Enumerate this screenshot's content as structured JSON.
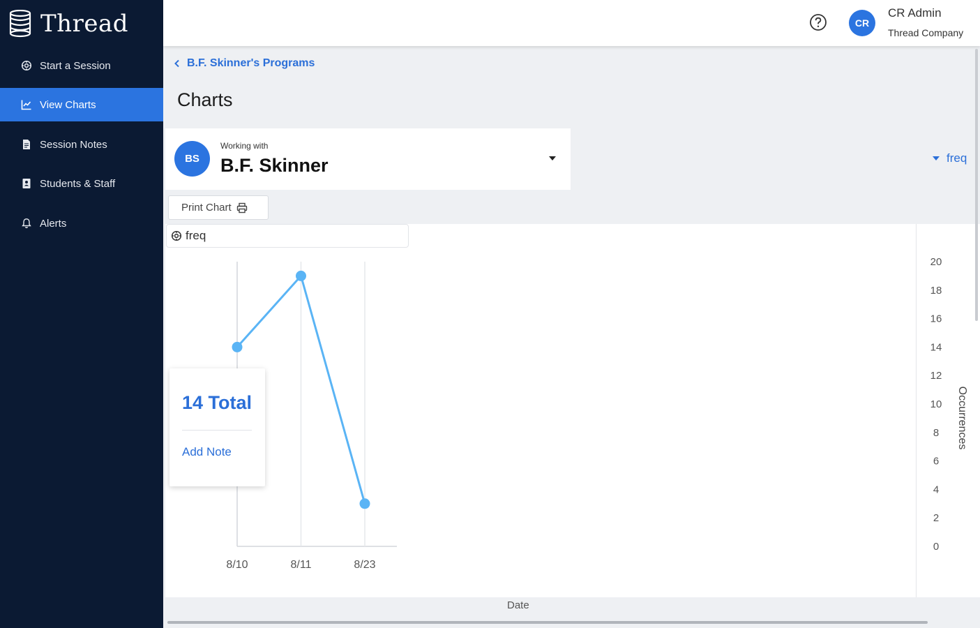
{
  "app": {
    "name": "Thread"
  },
  "sidebar": {
    "items": [
      {
        "label": "Start a Session",
        "icon": "gear-icon",
        "active": false
      },
      {
        "label": "View Charts",
        "icon": "chart-icon",
        "active": true
      },
      {
        "label": "Session Notes",
        "icon": "document-icon",
        "active": false
      },
      {
        "label": "Students & Staff",
        "icon": "people-book-icon",
        "active": false
      },
      {
        "label": "Alerts",
        "icon": "bell-icon",
        "active": false
      }
    ]
  },
  "header": {
    "user": {
      "initials": "CR",
      "name": "CR Admin",
      "company": "Thread Company"
    }
  },
  "breadcrumb": {
    "label": "B.F. Skinner's Programs"
  },
  "page": {
    "title": "Charts"
  },
  "student": {
    "prefix": "Working with",
    "initials": "BS",
    "name": "B.F. Skinner"
  },
  "metric_selector": {
    "value": "freq"
  },
  "toolbar": {
    "print_label": "Print Chart"
  },
  "legend": {
    "label": "freq"
  },
  "note_card": {
    "total": "14 Total",
    "add_note": "Add Note"
  },
  "colors": {
    "accent": "#2b74e0",
    "sidebar": "#0b1a33",
    "series": "#5ab4f5"
  },
  "chart_data": {
    "type": "line",
    "title": "",
    "xlabel": "Date",
    "ylabel": "Occurrences",
    "ylim": [
      0,
      20
    ],
    "yticks": [
      0,
      2,
      4,
      6,
      8,
      10,
      12,
      14,
      16,
      18,
      20
    ],
    "categories": [
      "8/10",
      "8/11",
      "8/23"
    ],
    "series": [
      {
        "values": [
          14,
          19,
          3
        ]
      }
    ],
    "grid": "vertical"
  }
}
